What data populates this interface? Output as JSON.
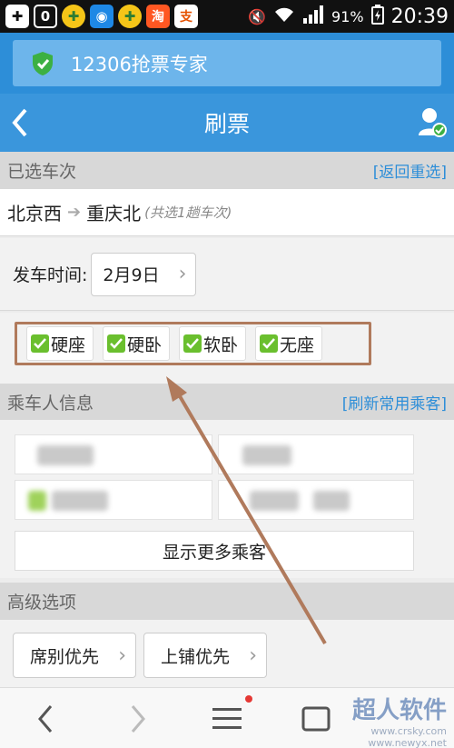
{
  "status_bar": {
    "battery": "91%",
    "time": "20:39",
    "app_icons": [
      "add-icon",
      "zero-app-icon",
      "plus-app-icon",
      "browser-app-icon",
      "plus-app-icon",
      "taobao-icon",
      "alipay-icon"
    ],
    "taobao_glyph": "淘",
    "alipay_glyph": "支",
    "zero_glyph": "0"
  },
  "browser": {
    "page_title": "12306抢票专家"
  },
  "header": {
    "title": "刷票"
  },
  "selected_trains": {
    "heading": "已选车次",
    "reselect": "[返回重选]",
    "from": "北京西",
    "to": "重庆北",
    "note": "(共选1趟车次)",
    "arrow": "➔"
  },
  "departure": {
    "label": "发车时间:",
    "date": "2月9日"
  },
  "seat_types": [
    "硬座",
    "硬卧",
    "软卧",
    "无座"
  ],
  "passengers": {
    "heading": "乘车人信息",
    "refresh": "[刷新常用乘客]",
    "show_more": "显示更多乘客"
  },
  "advanced": {
    "heading": "高级选项",
    "seat_priority": "席别优先",
    "upper_berth_priority": "上铺优先"
  },
  "watermark": {
    "line1": "超人软件",
    "line2": "www.crsky.com",
    "line3": "www.newyx.net"
  },
  "colors": {
    "primary": "#3a96dc",
    "link": "#2d8ed8",
    "check": "#6abf2e",
    "highlight_frame": "#b07a5c"
  }
}
